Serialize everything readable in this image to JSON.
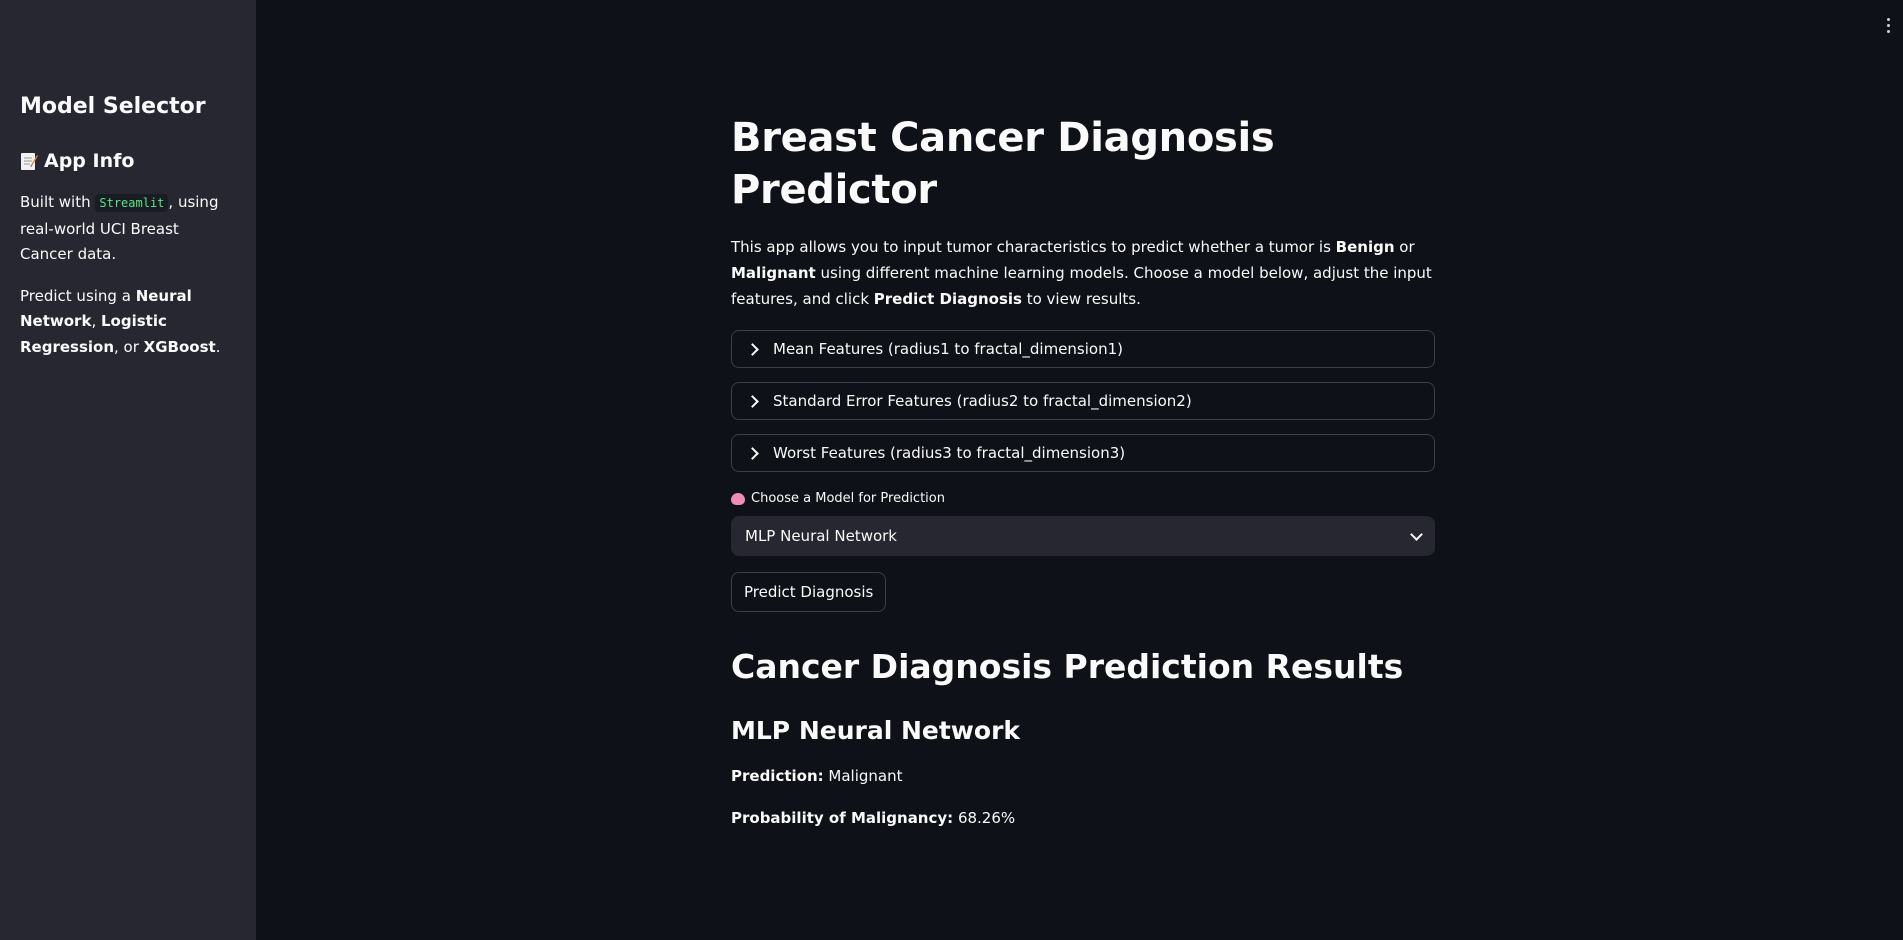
{
  "sidebar": {
    "title": "Model Selector",
    "app_info_heading": "App Info",
    "app_info_icon": "memo-icon",
    "built_with_prefix": "Built with ",
    "built_with_code": "Streamlit",
    "built_with_suffix": ", using real-world UCI Breast Cancer data.",
    "predict_prefix": "Predict using a ",
    "model1": "Neural Network",
    "sep1": ", ",
    "model2": "Logistic Regression",
    "sep2": ", or ",
    "model3": "XGBoost",
    "end": "."
  },
  "main": {
    "title": "Breast Cancer Diagnosis Predictor",
    "intro": {
      "part1": "This app allows you to input tumor characteristics to predict whether a tumor is ",
      "benign": "Benign",
      "or": " or ",
      "malignant": "Malignant",
      "part2": " using different machine learning models. Choose a model below, adjust the input features, and click ",
      "predict": "Predict Diagnosis",
      "part3": " to view results."
    },
    "expanders": [
      {
        "label": "Mean Features (radius1 to fractal_dimension1)"
      },
      {
        "label": "Standard Error Features (radius2 to fractal_dimension2)"
      },
      {
        "label": "Worst Features (radius3 to fractal_dimension3)"
      }
    ],
    "select_label": "Choose a Model for Prediction",
    "select_icon": "brain-icon",
    "select_value": "MLP Neural Network",
    "predict_button": "Predict Diagnosis",
    "results_title": "Cancer Diagnosis Prediction Results",
    "model_title": "MLP Neural Network",
    "prediction_label": "Prediction:",
    "prediction_value": "Malignant",
    "probability_label": "Probability of Malignancy:",
    "probability_value": "68.26%"
  },
  "colors": {
    "background": "#0e1117",
    "sidebar": "#262730",
    "code_text": "#5ce488"
  }
}
